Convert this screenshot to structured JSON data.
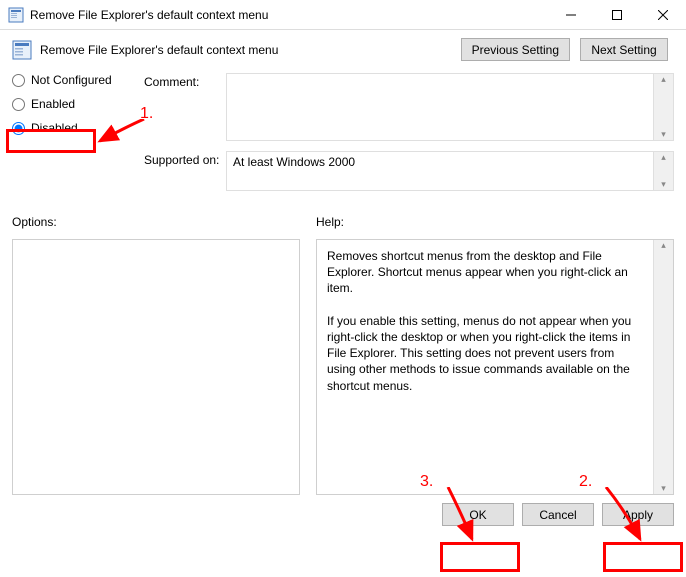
{
  "window": {
    "title": "Remove File Explorer's default context menu"
  },
  "header": {
    "title": "Remove File Explorer's default context menu",
    "previous_setting": "Previous Setting",
    "next_setting": "Next Setting"
  },
  "radios": {
    "not_configured": "Not Configured",
    "enabled": "Enabled",
    "disabled": "Disabled",
    "selected": "disabled"
  },
  "fields": {
    "comment_label": "Comment:",
    "comment_value": "",
    "supported_label": "Supported on:",
    "supported_value": "At least Windows 2000"
  },
  "panels": {
    "options_label": "Options:",
    "help_label": "Help:",
    "help_text_p1": "Removes shortcut menus from the desktop and File Explorer. Shortcut menus appear when you right-click an item.",
    "help_text_p2": "If you enable this setting, menus do not appear when you right-click the desktop or when you right-click the items in File Explorer. This setting does not prevent users from using other methods to issue commands available on the shortcut menus."
  },
  "buttons": {
    "ok": "OK",
    "cancel": "Cancel",
    "apply": "Apply"
  },
  "annotations": {
    "step1": "1.",
    "step2": "2.",
    "step3": "3."
  }
}
